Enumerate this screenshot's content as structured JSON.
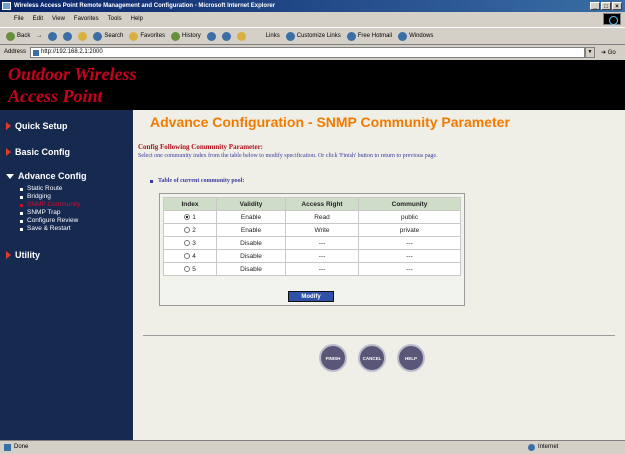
{
  "window": {
    "title": "Wireless Access Point Remote Management and Configuration - Microsoft Internet Explorer",
    "controls": [
      "_",
      "□",
      "×"
    ]
  },
  "menu": [
    "File",
    "Edit",
    "View",
    "Favorites",
    "Tools",
    "Help"
  ],
  "toolbar": {
    "back": "Back",
    "forward": "→",
    "search": "Search",
    "favorites": "Favorites",
    "history": "History",
    "links": "Links",
    "customize": "Customize Links",
    "hotmail": "Free Hotmail",
    "windows": "Windows"
  },
  "address": {
    "label": "Address",
    "url": "http://192.168.2.1:2000",
    "go": "Go"
  },
  "banner": {
    "line1": "Outdoor Wireless",
    "line2": "Access Point"
  },
  "sidebar": {
    "quick_setup": "Quick Setup",
    "basic_config": "Basic Config",
    "advance_config": "Advance Config",
    "sub_items": [
      "Static Route",
      "Bridging",
      "SNMP Community",
      "SNMP Trap",
      "Configure Review",
      "Save & Restart"
    ],
    "utility": "Utility"
  },
  "main": {
    "heading": "Advance Configuration - SNMP Community Parameter",
    "config_title": "Config Following Community Parameter:",
    "config_desc": "Select one community index from the table below to modify specification. Or click 'Finish' button to return to previous page.",
    "table_title": "Table of current community pool:",
    "columns": [
      "Index",
      "Validity",
      "Access Right",
      "Community"
    ],
    "rows": [
      {
        "index": "1",
        "validity": "Enable",
        "access": "Read",
        "community": "public",
        "selected": true
      },
      {
        "index": "2",
        "validity": "Enable",
        "access": "Write",
        "community": "private",
        "selected": false
      },
      {
        "index": "3",
        "validity": "Disable",
        "access": "---",
        "community": "---",
        "selected": false
      },
      {
        "index": "4",
        "validity": "Disable",
        "access": "---",
        "community": "---",
        "selected": false
      },
      {
        "index": "5",
        "validity": "Disable",
        "access": "---",
        "community": "---",
        "selected": false
      }
    ],
    "modify_label": "Modify",
    "buttons": {
      "finish": "FINISH",
      "cancel": "CANCEL",
      "help": "HELP"
    }
  },
  "status": {
    "left": "Done",
    "right": "Internet"
  }
}
